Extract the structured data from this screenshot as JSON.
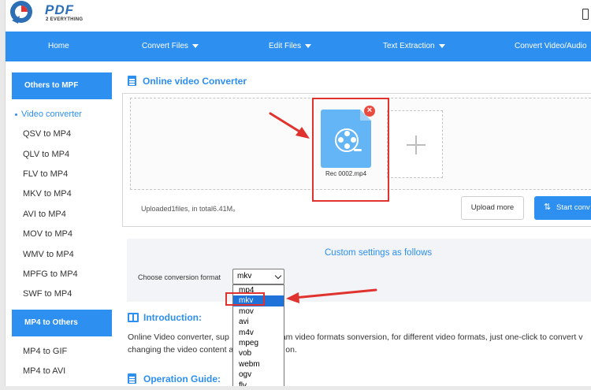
{
  "brand": {
    "name": "PDF",
    "tagline": "2 EVERYTHING",
    "primary_color": "#2d8ff0",
    "accent_red": "#e0322f"
  },
  "nav": {
    "items": [
      {
        "label": "Home",
        "dropdown": false
      },
      {
        "label": "Convert Files",
        "dropdown": true
      },
      {
        "label": "Edit Files",
        "dropdown": true
      },
      {
        "label": "Text Extraction",
        "dropdown": true
      },
      {
        "label": "Convert Video/Audio",
        "dropdown": true
      }
    ]
  },
  "sidebar": {
    "group1_title": "Others to MPF",
    "group1_items": [
      {
        "label": "Video converter",
        "active": true
      },
      {
        "label": "QSV to MP4"
      },
      {
        "label": "QLV to MP4"
      },
      {
        "label": "FLV to MP4"
      },
      {
        "label": "MKV to MP4"
      },
      {
        "label": "AVI to MP4"
      },
      {
        "label": "MOV to MP4"
      },
      {
        "label": "WMV to MP4"
      },
      {
        "label": "MPFG to MP4"
      },
      {
        "label": "SWF to MP4"
      }
    ],
    "group2_title": "MP4 to Others",
    "group2_items": [
      {
        "label": "MP4 to GIF"
      },
      {
        "label": "MP4 to AVI"
      }
    ]
  },
  "main": {
    "title": "Online video Converter",
    "file": {
      "name": "Rec 0002.mp4",
      "remove_glyph": "×",
      "icon": "video-file-icon"
    },
    "add_glyph": "+",
    "status": "Uploaded1files, in total6.41M。",
    "upload_more": "Upload more",
    "start": "Start conv",
    "settings_title": "Custom settings as follows",
    "format_label": "Choose conversion format",
    "format_selected": "mkv",
    "format_options": [
      "mp4",
      "mkv",
      "mov",
      "avi",
      "m4v",
      "mpeg",
      "vob",
      "webm",
      "ogv",
      "flv"
    ],
    "intro_title": "Introduction:",
    "intro_line1_a": "Online Video converter, sup",
    "intro_line1_b": "am video formats sonversion, for different video formats, just one-click to convert v",
    "intro_line2_a": "changing the video content a",
    "intro_line2_b": "on.",
    "guide_title": "Operation Guide:"
  }
}
